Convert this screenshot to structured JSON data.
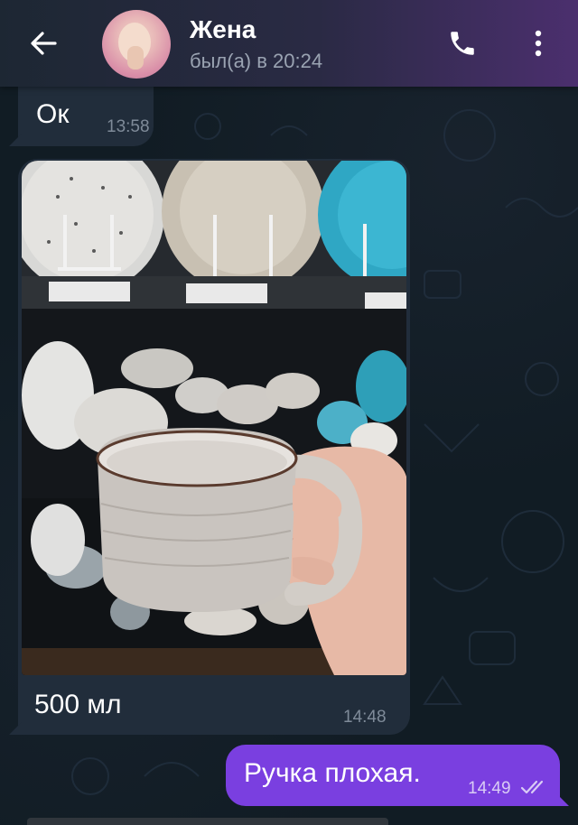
{
  "header": {
    "contact_name": "Жена",
    "status": "был(а) в 20:24"
  },
  "icons": {
    "back": "arrow-left-icon",
    "call": "phone-icon",
    "menu": "more-vertical-icon",
    "read": "double-check-icon"
  },
  "messages": [
    {
      "direction": "incoming",
      "text": "Ок",
      "time": "13:58"
    },
    {
      "direction": "incoming",
      "type": "photo",
      "caption": "500 мл",
      "time": "14:48"
    },
    {
      "direction": "outgoing",
      "text": "Ручка плохая.",
      "time": "14:49",
      "read": true
    }
  ],
  "colors": {
    "incoming_bubble": "#212d3b",
    "outgoing_bubble": "#7a3fe0",
    "background": "#111c24"
  }
}
